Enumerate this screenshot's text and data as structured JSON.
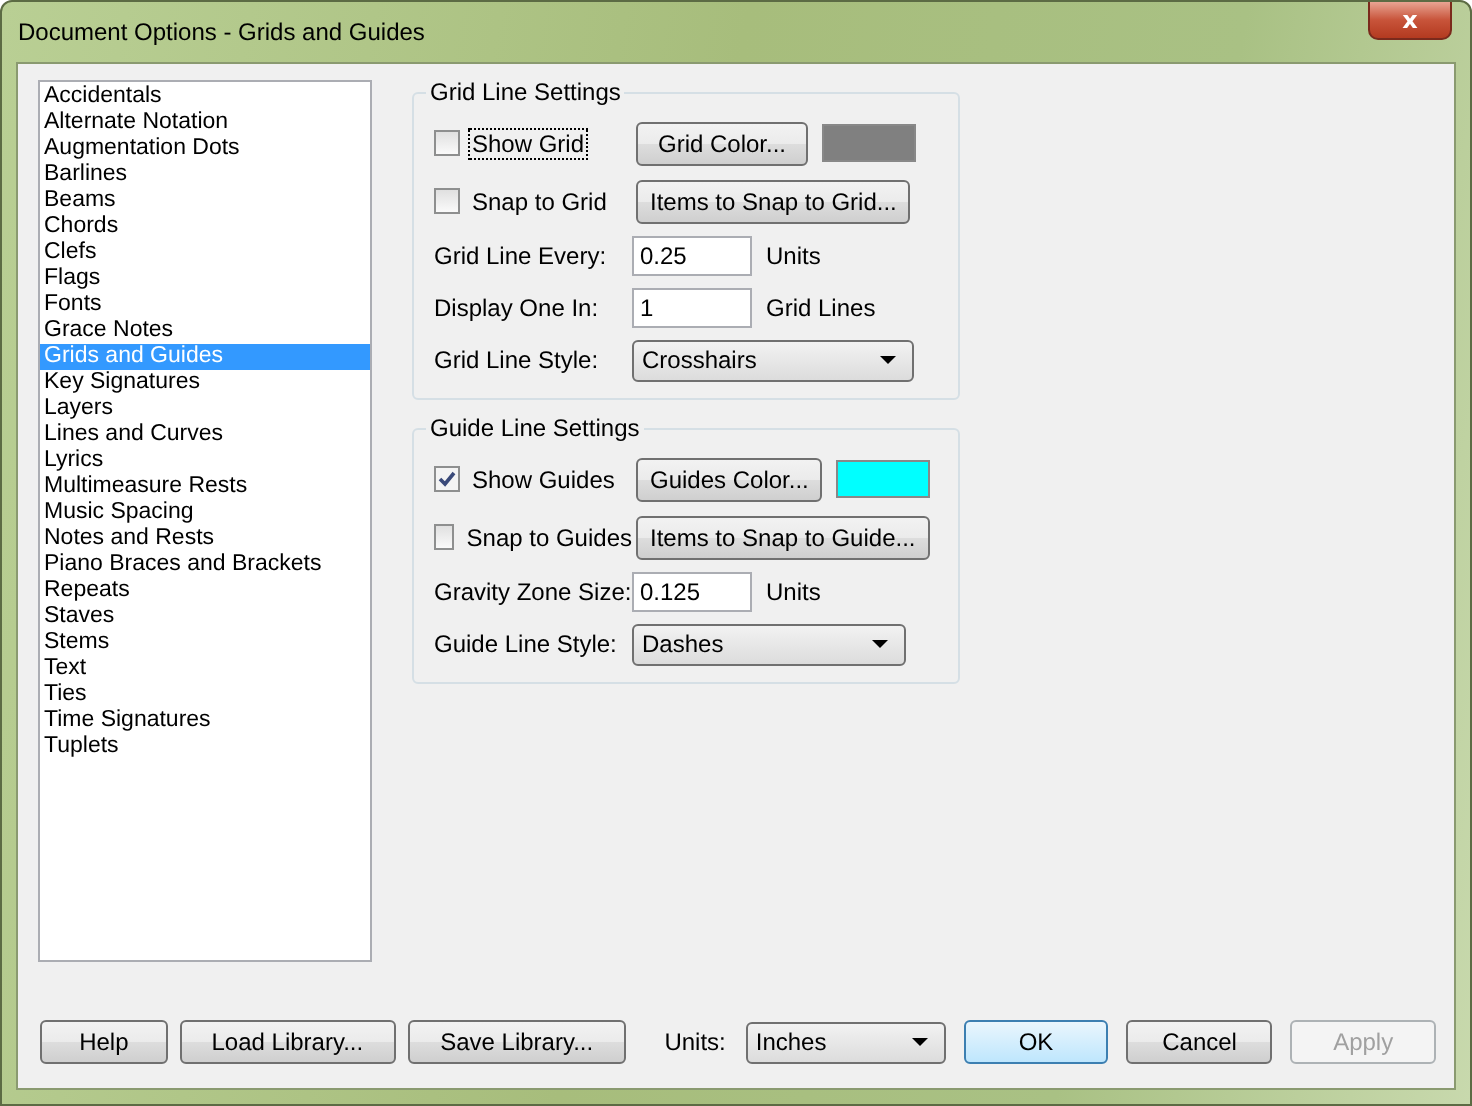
{
  "window": {
    "title": "Document Options - Grids and Guides",
    "close": "x"
  },
  "categories": [
    {
      "label": "Accidentals",
      "selected": false
    },
    {
      "label": "Alternate Notation",
      "selected": false
    },
    {
      "label": "Augmentation Dots",
      "selected": false
    },
    {
      "label": "Barlines",
      "selected": false
    },
    {
      "label": "Beams",
      "selected": false
    },
    {
      "label": "Chords",
      "selected": false
    },
    {
      "label": "Clefs",
      "selected": false
    },
    {
      "label": "Flags",
      "selected": false
    },
    {
      "label": "Fonts",
      "selected": false
    },
    {
      "label": "Grace Notes",
      "selected": false
    },
    {
      "label": "Grids and Guides",
      "selected": true
    },
    {
      "label": "Key Signatures",
      "selected": false
    },
    {
      "label": "Layers",
      "selected": false
    },
    {
      "label": "Lines and Curves",
      "selected": false
    },
    {
      "label": "Lyrics",
      "selected": false
    },
    {
      "label": "Multimeasure Rests",
      "selected": false
    },
    {
      "label": "Music Spacing",
      "selected": false
    },
    {
      "label": "Notes and Rests",
      "selected": false
    },
    {
      "label": "Piano Braces and Brackets",
      "selected": false
    },
    {
      "label": "Repeats",
      "selected": false
    },
    {
      "label": "Staves",
      "selected": false
    },
    {
      "label": "Stems",
      "selected": false
    },
    {
      "label": "Text",
      "selected": false
    },
    {
      "label": "Ties",
      "selected": false
    },
    {
      "label": "Time Signatures",
      "selected": false
    },
    {
      "label": "Tuplets",
      "selected": false
    }
  ],
  "groups": [
    {
      "title": "Grid Line Settings",
      "rows": [
        {
          "kind": "check",
          "label": "Show Grid",
          "checked": false,
          "focused": true,
          "button": "Grid Color...",
          "color": "#808080"
        },
        {
          "kind": "check",
          "label": "Snap to Grid",
          "checked": false,
          "focused": false,
          "button": "Items to Snap to Grid..."
        },
        {
          "kind": "input",
          "label": "Grid Line Every:",
          "value": "0.25",
          "unit": "Units"
        },
        {
          "kind": "input",
          "label": "Display One In:",
          "value": "1",
          "unit": "Grid Lines"
        },
        {
          "kind": "select",
          "label": "Grid Line Style:",
          "value": "Crosshairs"
        }
      ]
    },
    {
      "title": "Guide Line Settings",
      "rows": [
        {
          "kind": "check",
          "label": "Show Guides",
          "checked": true,
          "focused": false,
          "button": "Guides Color...",
          "color": "#00ffff"
        },
        {
          "kind": "check",
          "label": "Snap to Guides",
          "checked": false,
          "focused": false,
          "button": "Items to Snap to Guide..."
        },
        {
          "kind": "input",
          "label": "Gravity Zone Size:",
          "value": "0.125",
          "unit": "Units"
        },
        {
          "kind": "select",
          "label": "Guide Line Style:",
          "value": "Dashes"
        }
      ]
    }
  ],
  "footer": {
    "left_buttons": [
      "Help",
      "Load Library...",
      "Save Library..."
    ],
    "units_label": "Units:",
    "units_value": "Inches",
    "actions": [
      {
        "label": "OK",
        "default": true,
        "disabled": false
      },
      {
        "label": "Cancel",
        "default": false,
        "disabled": false
      },
      {
        "label": "Apply",
        "default": false,
        "disabled": true
      }
    ]
  }
}
